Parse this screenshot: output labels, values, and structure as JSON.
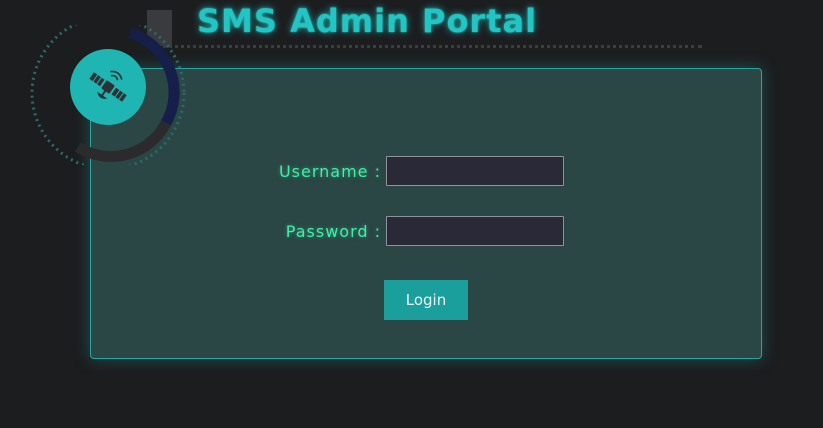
{
  "header": {
    "title": "SMS Admin Portal"
  },
  "emblem": {
    "icon": "satellite-icon"
  },
  "login_form": {
    "username_label": "Username :",
    "username_value": "",
    "password_label": "Password :",
    "password_value": "",
    "login_label": "Login"
  },
  "colors": {
    "background": "#1c1d1f",
    "title": "#22c5c3",
    "panel": "#2a4645",
    "panel_border": "#2ba5a1",
    "label": "#3ff0a5",
    "input_bg": "#2a2937",
    "button": "#1a9f9c"
  }
}
